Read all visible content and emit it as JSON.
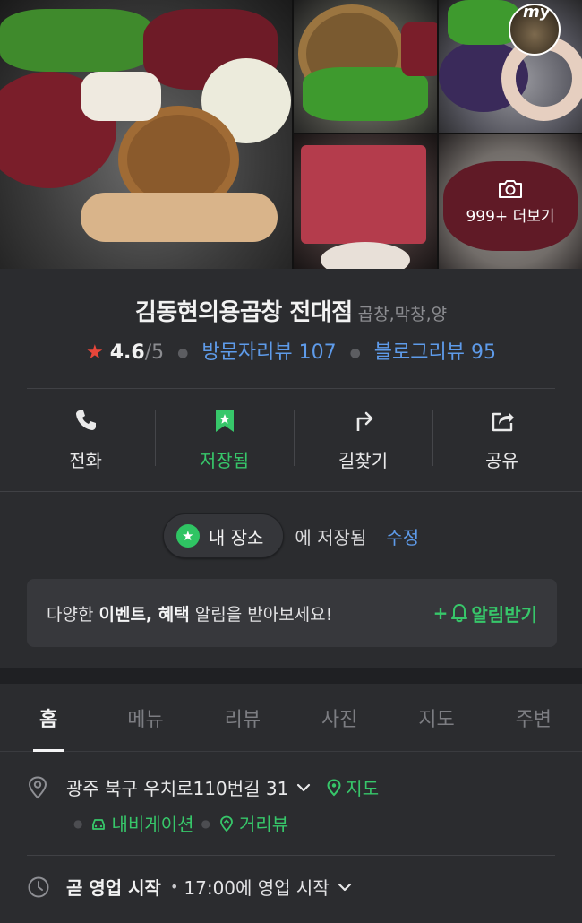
{
  "photos": {
    "more_label": "999+ 더보기",
    "badge_text": "my"
  },
  "place": {
    "name": "김동현의용곱창 전대점",
    "category": "곱창,막창,양",
    "rating_star": "★",
    "rating": "4.6",
    "rating_max": "/5",
    "visitor_reviews": "방문자리뷰 107",
    "blog_reviews": "블로그리뷰 95"
  },
  "actions": [
    {
      "label": "전화",
      "icon": "phone-icon"
    },
    {
      "label": "저장됨",
      "icon": "bookmark-icon"
    },
    {
      "label": "길찾기",
      "icon": "directions-icon"
    },
    {
      "label": "공유",
      "icon": "share-icon"
    }
  ],
  "saved": {
    "pill_star": "★",
    "list_name": "내 장소",
    "saved_text": "에 저장됨",
    "edit": "수정"
  },
  "banner": {
    "prefix": "다양한 ",
    "bold": "이벤트, 혜택",
    "suffix": " 알림을 받아보세요!",
    "notify_plus": "+",
    "notify_label": "알림받기"
  },
  "tabs": [
    {
      "label": "홈",
      "active": true
    },
    {
      "label": "메뉴",
      "active": false
    },
    {
      "label": "리뷰",
      "active": false
    },
    {
      "label": "사진",
      "active": false
    },
    {
      "label": "지도",
      "active": false
    },
    {
      "label": "주변",
      "active": false
    }
  ],
  "details": {
    "address": "광주 북구 우치로110번길 31",
    "map_link": "지도",
    "navigation": "내비게이션",
    "street_view": "거리뷰",
    "status": "곧 영업 시작",
    "hours": "17:00에 영업 시작"
  },
  "colors": {
    "background": "#2b2c2f",
    "accent_green": "#37c76a",
    "link_blue": "#5e9bea",
    "star_red": "#e8463a"
  }
}
